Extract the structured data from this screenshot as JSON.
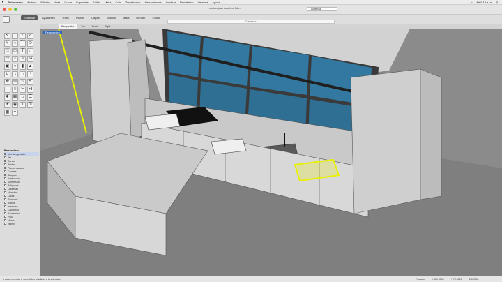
{
  "menubar": {
    "app_name": "Rhinoceros",
    "items": [
      "Archivo",
      "Edición",
      "Vista",
      "Curva",
      "Superficie",
      "Sólido",
      "Malla",
      "Cota",
      "Transformar",
      "Herramientas",
      "Analizar",
      "Renderizar",
      "Ventana",
      "Ayuda"
    ],
    "clock": "Mié 9:13 a. m."
  },
  "window": {
    "title": "cocina juan ranchos 3dm",
    "search_value": "cubiertas",
    "command_prompt": "Comando:"
  },
  "toolbar": {
    "tabs": [
      "Estándar",
      "Ayudantes",
      "Trans",
      "Planos",
      "Capas",
      "Sólidos",
      "Malla",
      "Render",
      "Cotas"
    ],
    "selected_tab": "Estándar"
  },
  "viewport": {
    "tabs": [
      "Perspective",
      "Top",
      "Front",
      "Right"
    ],
    "selected_tab": "Perspective",
    "label": "Perspective"
  },
  "layers": {
    "header": "Personalizar",
    "items": [
      "Uso designando",
      "Ter",
      "Curvas",
      "Puntos",
      "Planos usuario",
      "Cámara",
      "Bloques",
      "Iluminación",
      "Sombreado",
      "Polígonos",
      "Cubiertas",
      "Muebles",
      "Lacas",
      "Tiradores",
      "Vidrios",
      "Interiores",
      "Cajoneras",
      "Accesorios",
      "Piso",
      "Muros",
      "Techos"
    ]
  },
  "status": {
    "left": "1 curva cerrada, 2 superficies añadidas a la selección",
    "grid_snap": "Forzado",
    "x": "X 481.0000",
    "y": "Y 79.0000",
    "z": "Z 0.0000"
  },
  "colors": {
    "selection": "#e8f000",
    "glass": "#2f6f93",
    "frame": "#2c2c2c",
    "cabinet": "#d8d8d8"
  }
}
